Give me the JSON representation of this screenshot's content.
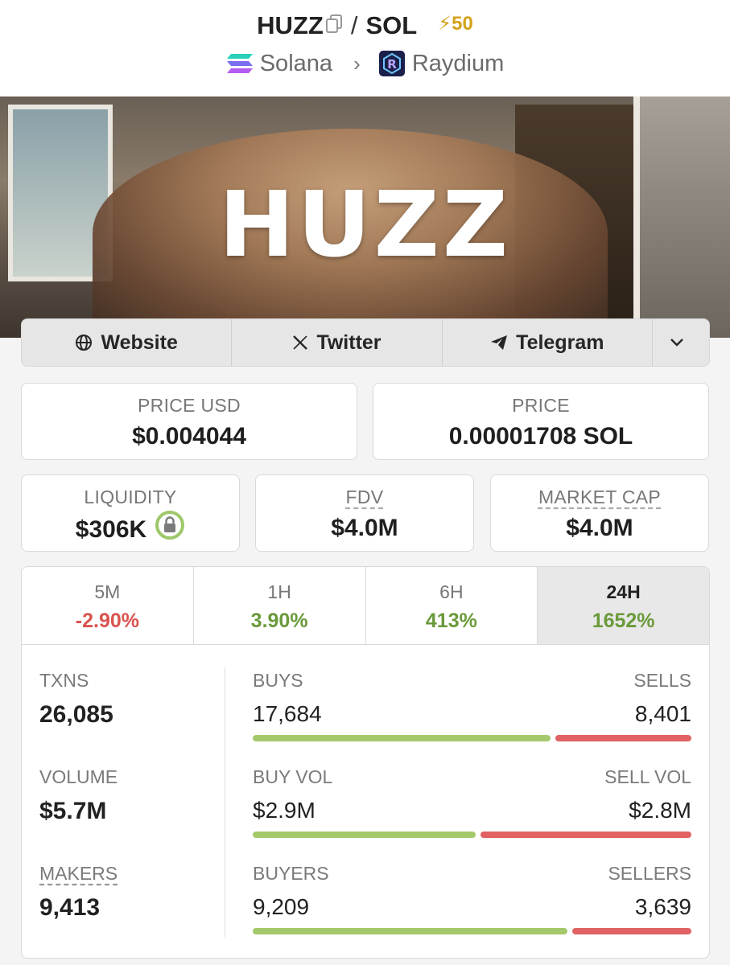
{
  "header": {
    "base_token": "HUZZ",
    "separator": "/",
    "quote_token": "SOL",
    "boost": "50",
    "chain": "Solana",
    "dex": "Raydium"
  },
  "banner": {
    "title": "HUZZ"
  },
  "links": {
    "website": "Website",
    "twitter": "Twitter",
    "telegram": "Telegram"
  },
  "prices": {
    "price_usd_label": "PRICE USD",
    "price_usd": "$0.004044",
    "price_label": "PRICE",
    "price_sol": "0.00001708 SOL",
    "liquidity_label": "LIQUIDITY",
    "liquidity": "$306K",
    "fdv_label": "FDV",
    "fdv": "$4.0M",
    "mcap_label": "MARKET CAP",
    "mcap": "$4.0M"
  },
  "tabs": [
    {
      "label": "5M",
      "value": "-2.90%"
    },
    {
      "label": "1H",
      "value": "3.90%"
    },
    {
      "label": "6H",
      "value": "413%"
    },
    {
      "label": "24H",
      "value": "1652%"
    }
  ],
  "stats": {
    "txns_label": "TXNS",
    "txns": "26,085",
    "volume_label": "VOLUME",
    "volume": "$5.7M",
    "makers_label": "MAKERS",
    "makers": "9,413",
    "buys_label": "BUYS",
    "buys": "17,684",
    "sells_label": "SELLS",
    "sells": "8,401",
    "buys_fraction": 0.678,
    "buyvol_label": "BUY VOL",
    "buyvol": "$2.9M",
    "sellvol_label": "SELL VOL",
    "sellvol": "$2.8M",
    "buyvol_fraction": 0.509,
    "buyers_label": "BUYERS",
    "buyers": "9,209",
    "sellers_label": "SELLERS",
    "sellers": "3,639",
    "buyers_fraction": 0.717
  },
  "colors": {
    "positive": "#6a9a3a",
    "negative": "#d9534f",
    "boost": "#d4a21a"
  },
  "icons": [
    "copy-icon",
    "lightning-icon",
    "solana-icon",
    "chevron-right-icon",
    "raydium-icon",
    "globe-icon",
    "x-icon",
    "telegram-icon",
    "chevron-down-icon",
    "lock-icon"
  ]
}
